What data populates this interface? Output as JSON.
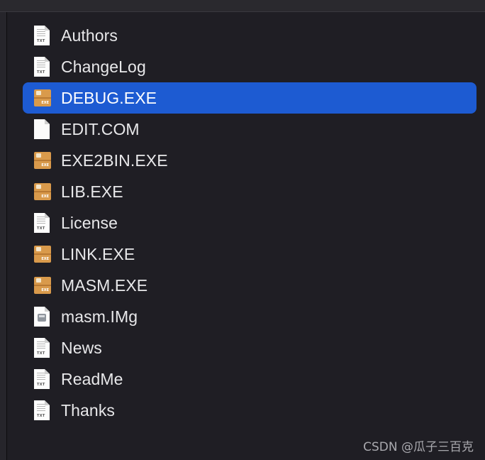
{
  "files": [
    {
      "name": "Authors",
      "icon": "text-document-icon",
      "tag": "TXT",
      "selected": false
    },
    {
      "name": "ChangeLog",
      "icon": "text-document-icon",
      "tag": "TXT",
      "selected": false
    },
    {
      "name": "DEBUG.EXE",
      "icon": "executable-icon",
      "tag": "EXE",
      "selected": true
    },
    {
      "name": "EDIT.COM",
      "icon": "blank-document-icon",
      "tag": "",
      "selected": false
    },
    {
      "name": "EXE2BIN.EXE",
      "icon": "executable-icon",
      "tag": "EXE",
      "selected": false
    },
    {
      "name": "LIB.EXE",
      "icon": "executable-icon",
      "tag": "EXE",
      "selected": false
    },
    {
      "name": "License",
      "icon": "text-document-icon",
      "tag": "TXT",
      "selected": false
    },
    {
      "name": "LINK.EXE",
      "icon": "executable-icon",
      "tag": "EXE",
      "selected": false
    },
    {
      "name": "MASM.EXE",
      "icon": "executable-icon",
      "tag": "EXE",
      "selected": false
    },
    {
      "name": "masm.IMg",
      "icon": "disk-image-icon",
      "tag": "",
      "selected": false
    },
    {
      "name": "News",
      "icon": "text-document-icon",
      "tag": "TXT",
      "selected": false
    },
    {
      "name": "ReadMe",
      "icon": "text-document-icon",
      "tag": "TXT",
      "selected": false
    },
    {
      "name": "Thanks",
      "icon": "text-document-icon",
      "tag": "TXT",
      "selected": false
    }
  ],
  "watermark": "CSDN @瓜子三百克",
  "colors": {
    "background": "#1f1e24",
    "selection": "#1d5bd2",
    "text": "#e8e8ea"
  }
}
